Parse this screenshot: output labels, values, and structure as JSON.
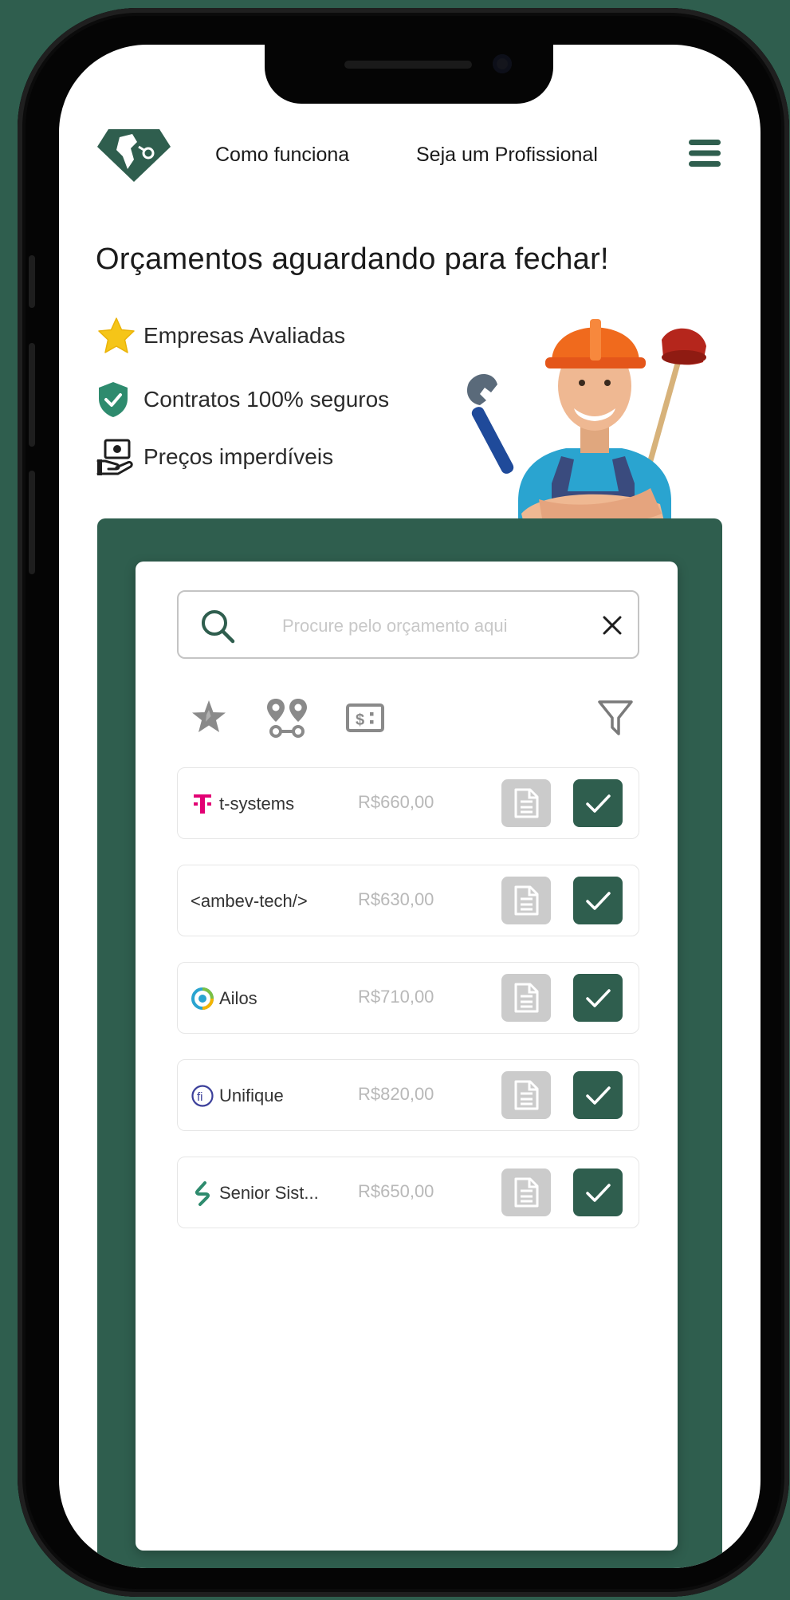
{
  "nav": {
    "links": [
      "Como funciona",
      "Seja um Profissional"
    ]
  },
  "hero": {
    "headline": "Orçamentos aguardando para fechar!",
    "features": [
      {
        "icon": "star-icon",
        "label": "Empresas Avaliadas"
      },
      {
        "icon": "shield-check-icon",
        "label": "Contratos 100% seguros"
      },
      {
        "icon": "money-hand-icon",
        "label": "Preços imperdíveis"
      }
    ]
  },
  "search": {
    "placeholder": "Procure pelo orçamento aqui",
    "value": ""
  },
  "filters": [
    "star-filter-icon",
    "location-filter-icon",
    "price-filter-icon",
    "funnel-icon"
  ],
  "quotes": [
    {
      "company": "t-systems",
      "price": "R$660,00"
    },
    {
      "company": "<ambev-tech/>",
      "price": "R$630,00"
    },
    {
      "company": "Ailos",
      "price": "R$710,00"
    },
    {
      "company": "Unifique",
      "price": "R$820,00"
    },
    {
      "company": "Senior Sist...",
      "price": "R$650,00"
    }
  ],
  "colors": {
    "brand": "#2f5e4e",
    "background": "#2f5e4e",
    "star": "#f5c518",
    "shield": "#2e8b6e",
    "telekom": "#e20074"
  }
}
